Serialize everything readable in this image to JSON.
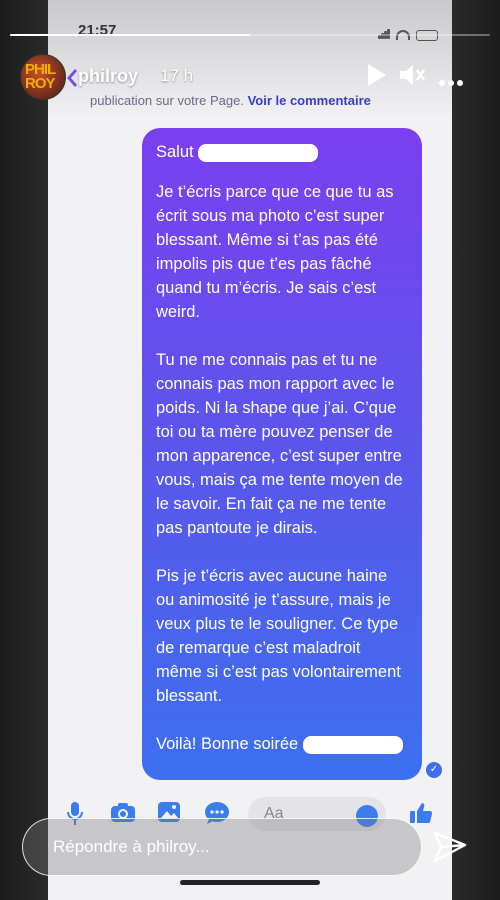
{
  "device": {
    "time": "21:57"
  },
  "story": {
    "username": "philroy",
    "time_ago": "17 h",
    "avatar_text": "PHIL ROY",
    "progress": 0.5,
    "reply_placeholder": "Répondre à philroy..."
  },
  "screenshot": {
    "notice_text": "publication sur votre Page.",
    "notice_link": "Voir le commentaire"
  },
  "message": {
    "greeting": "Salut",
    "paragraphs": [
      "Je t’écris parce que ce que tu as écrit sous ma photo c’est super blessant. Même si t’as pas été impolis pis que t’es pas fâché quand tu m’écris. Je sais c’est weird.",
      "Tu ne me connais pas et tu ne connais pas mon rapport avec le poids. Ni la shape que j’ai. C’que toi ou ta mère pouvez penser de mon apparence, c’est super entre vous, mais ça me tente moyen de le savoir. En fait ça ne me tente pas pantoute je dirais.",
      "Pis je t’écris avec aucune haine ou animosité je t’assure, mais je veux plus te le souligner. Ce type de remarque c’est maladroit même si c’est pas volontairement blessant."
    ],
    "closing": "Voilà! Bonne soirée"
  },
  "composer": {
    "placeholder": "Aa"
  },
  "colors": {
    "bubble_top": "#7b3ff0",
    "bubble_bottom": "#3d6ff0",
    "messenger_blue": "#3b7df0"
  }
}
